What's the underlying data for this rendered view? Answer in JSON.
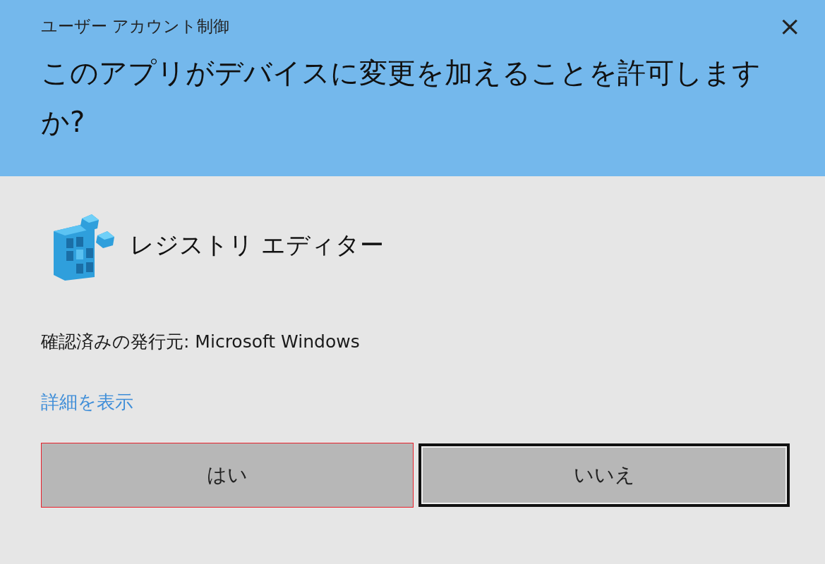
{
  "window": {
    "title": "ユーザー アカウント制御",
    "close": "×"
  },
  "question": "このアプリがデバイスに変更を加えることを許可しますか?",
  "app": {
    "name": "レジストリ エディター"
  },
  "publisher": "確認済みの発行元: Microsoft Windows",
  "details_link": "詳細を表示",
  "buttons": [
    {
      "label": "はい",
      "focused": false,
      "highlighted": true
    },
    {
      "label": "いいえ",
      "focused": true,
      "highlighted": false
    }
  ]
}
